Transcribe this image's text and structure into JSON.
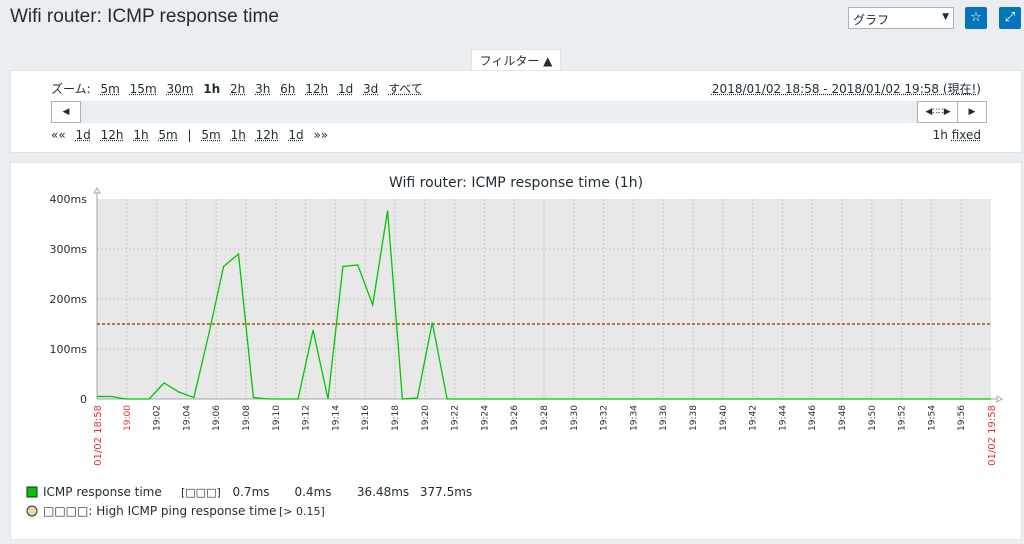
{
  "header": {
    "title": "Wifi router: ICMP response time",
    "view_select": "グラフ",
    "favorite_icon": "star-icon",
    "fullscreen_icon": "expand-icon"
  },
  "filter": {
    "tab_label": "フィルター ▲",
    "zoom_label": "ズーム:",
    "zoom_options": [
      "5m",
      "15m",
      "30m",
      "1h",
      "2h",
      "3h",
      "6h",
      "12h",
      "1d",
      "3d",
      "すべて"
    ],
    "zoom_selected": "1h",
    "range": "2018/01/02 18:58 - 2018/01/02 19:58 (現在!)",
    "nav_back": [
      "««",
      "1d",
      "12h",
      "1h",
      "5m"
    ],
    "nav_sep": "|",
    "nav_fwd": [
      "5m",
      "1h",
      "12h",
      "1d",
      "»»"
    ],
    "period": "1h",
    "fixed": "fixed"
  },
  "colors": {
    "series": "#00c800",
    "trigger": "#b35000",
    "time_edge": "#e8302a",
    "plot_bg": "#e8e8e8",
    "accent": "#0275b8"
  },
  "chart_data": {
    "type": "line",
    "title": "Wifi router: ICMP response time (1h)",
    "y_ticks": [
      "400ms",
      "300ms",
      "200ms",
      "100ms",
      "0"
    ],
    "ylim": [
      0,
      400
    ],
    "x_start_label": "01/02 18:58",
    "x_end_label": "01/02 19:58",
    "x_tick_labels": [
      "19:00",
      "19:02",
      "19:04",
      "19:06",
      "19:08",
      "19:10",
      "19:12",
      "19:14",
      "19:16",
      "19:18",
      "19:20",
      "19:22",
      "19:24",
      "19:26",
      "19:28",
      "19:30",
      "19:32",
      "19:34",
      "19:36",
      "19:38",
      "19:40",
      "19:42",
      "19:44",
      "19:46",
      "19:48",
      "19:50",
      "19:52",
      "19:54",
      "19:56"
    ],
    "xlim": [
      0,
      60
    ],
    "grid": true,
    "series": [
      {
        "name": "ICMP response time",
        "x": [
          0,
          1,
          1.5,
          2,
          3.5,
          4.5,
          5.5,
          6.5,
          7.5,
          8.5,
          9.5,
          10.5,
          11.5,
          12.5,
          13.5,
          14.5,
          15.5,
          16.5,
          17.5,
          18.5,
          19.5,
          20.5,
          21.5,
          22.5,
          23.5,
          24.5,
          25.5,
          60
        ],
        "values": [
          5,
          5,
          2,
          0,
          0,
          32,
          14,
          3,
          130,
          265,
          290,
          3,
          0,
          0,
          0,
          138,
          0,
          265,
          268,
          188,
          377,
          0,
          2,
          153,
          0,
          0,
          0,
          0
        ]
      }
    ],
    "trigger_line": {
      "value": 150
    },
    "legend": {
      "headers": [
        "",
        "",
        "",
        ""
      ],
      "rows": [
        {
          "name": "ICMP response time",
          "func": "[□□□]",
          "last": "0.7ms",
          "min": "0.4ms",
          "avg": "36.48ms",
          "max": "377.5ms"
        },
        {
          "name": "□□□□: High ICMP ping response time",
          "condition": "[> 0.15]"
        }
      ]
    }
  }
}
